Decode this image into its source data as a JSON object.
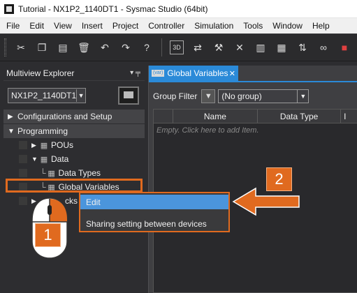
{
  "window": {
    "title": "Tutorial - NX1P2_1140DT1 - Sysmac Studio (64bit)"
  },
  "menu": [
    "File",
    "Edit",
    "View",
    "Insert",
    "Project",
    "Controller",
    "Simulation",
    "Tools",
    "Window",
    "Help"
  ],
  "toolbar": {
    "buttons": [
      "cut-icon",
      "copy-icon",
      "paste-icon",
      "delete-icon",
      "undo-icon",
      "redo-icon",
      "help-icon",
      "3d-icon",
      "sync-icon",
      "build-icon",
      "online-icon",
      "monitor-icon",
      "io-icon",
      "transfer-icon",
      "binoculars-icon",
      "stop-icon"
    ],
    "three_d_label": "3D",
    "help_label": "?"
  },
  "explorer": {
    "title": "Multiview Explorer",
    "pin_glyph": "▾ ╤",
    "device": "NX1P2_1140DT1",
    "sections": [
      {
        "label": "Configurations and Setup",
        "arrow": "▶"
      },
      {
        "label": "Programming",
        "arrow": "▼"
      }
    ],
    "tree": [
      {
        "label": "POUs",
        "arrow": "▶",
        "icon": "▦"
      },
      {
        "label": "Data",
        "arrow": "▼",
        "icon": "▦"
      },
      {
        "label": "Data Types",
        "icon": "▦"
      },
      {
        "label": "Global Variables",
        "icon": "▦"
      },
      {
        "label": "cks",
        "arrow": "▶",
        "icon": ""
      }
    ]
  },
  "editor": {
    "tab": {
      "icon_text": "(var)",
      "label": "Global Variables",
      "close": "✕"
    },
    "group_filter_label": "Group Filter",
    "group_filter_value": "(No group)",
    "columns": [
      "Name",
      "Data Type",
      "I"
    ],
    "empty_hint": "Empty. Click here to add Item."
  },
  "context_menu": {
    "items": [
      "Edit",
      "Sharing setting between devices"
    ],
    "highlighted_index": 0
  },
  "callouts": {
    "one": "1",
    "two": "2"
  },
  "colors": {
    "accent_orange": "#e06a1f",
    "tab_blue": "#2b8ad8",
    "menu_highlight": "#4b95dc"
  }
}
